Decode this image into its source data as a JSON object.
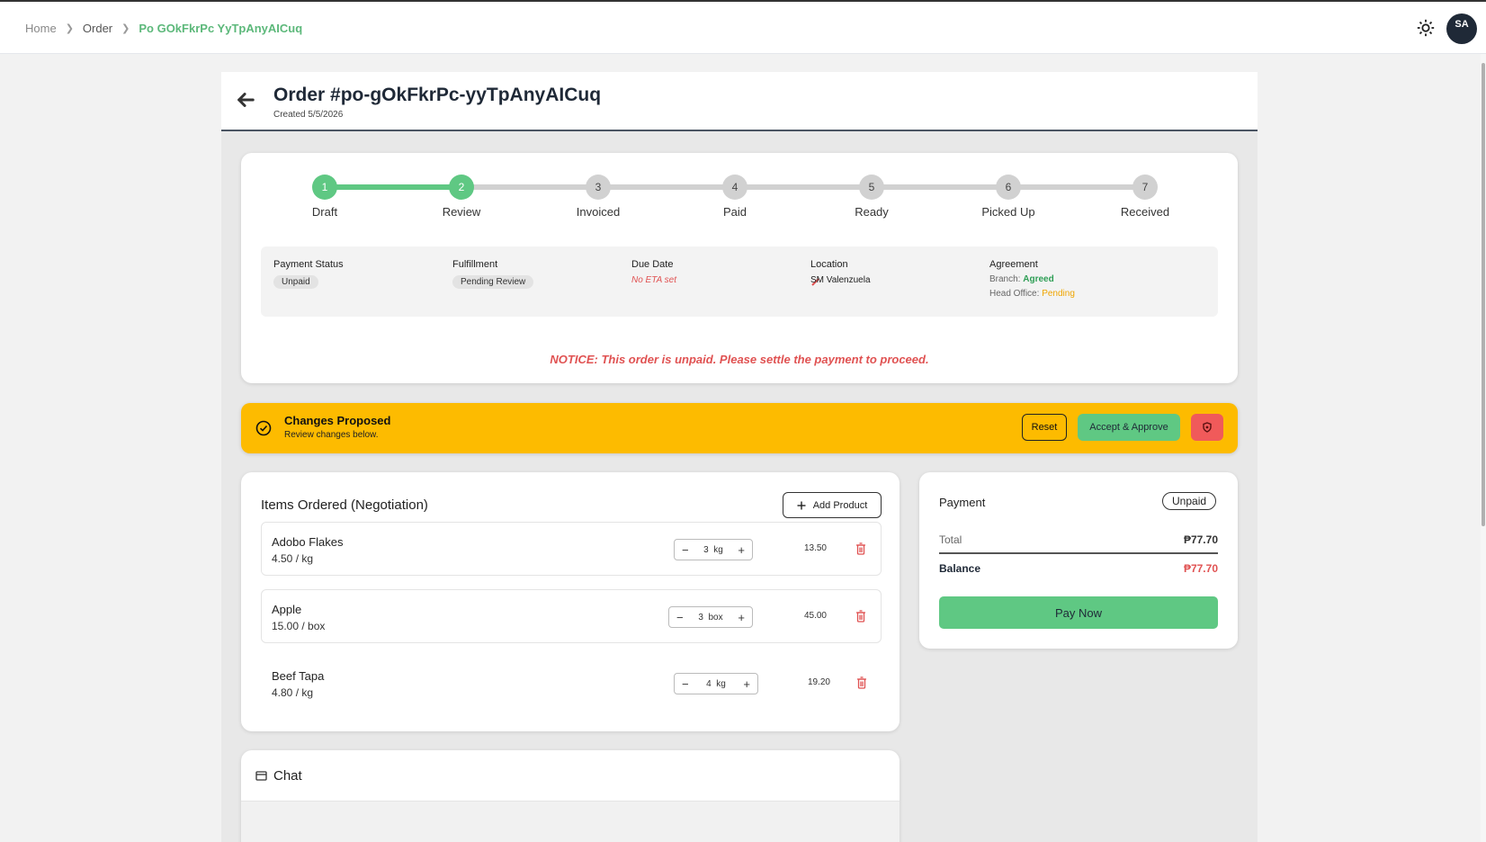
{
  "breadcrumb": {
    "home": "Home",
    "order": "Order",
    "current": "Po GOkFkrPc YyTpAnyAICuq"
  },
  "user": {
    "initials": "SA"
  },
  "order": {
    "title": "Order #po-gOkFkrPc-yyTpAnyAICuq",
    "created": "Created 5/5/2026"
  },
  "progress": {
    "current_step": 2,
    "steps": [
      {
        "num": "1",
        "label": "Draft"
      },
      {
        "num": "2",
        "label": "Review"
      },
      {
        "num": "3",
        "label": "Invoiced"
      },
      {
        "num": "4",
        "label": "Paid"
      },
      {
        "num": "5",
        "label": "Ready"
      },
      {
        "num": "6",
        "label": "Picked Up"
      },
      {
        "num": "7",
        "label": "Received"
      }
    ]
  },
  "info": {
    "payment_status_label": "Payment Status",
    "payment_status": "Unpaid",
    "fulfillment_label": "Fulfillment",
    "fulfillment": "Pending Review",
    "due_date_label": "Due Date",
    "due_date": "No ETA set",
    "location_label": "Location",
    "location": "SM Valenzuela",
    "agreement_label": "Agreement",
    "branch_label": "Branch:",
    "branch_status": "Agreed",
    "head_office_label": "Head Office:",
    "head_office_status": "Pending"
  },
  "notice": "NOTICE: This order is unpaid. Please settle the payment to proceed.",
  "banner": {
    "title": "Changes Proposed",
    "subtitle": "Review changes below.",
    "reset": "Reset",
    "accept": "Accept & Approve"
  },
  "items": {
    "title": "Items Ordered (Negotiation)",
    "add_label": "Add Product",
    "list": [
      {
        "name": "Adobo Flakes",
        "price": "4.50 / kg",
        "qty": "3",
        "unit": "kg",
        "subtotal": "13.50"
      },
      {
        "name": "Apple",
        "price": "15.00 / box",
        "qty": "3",
        "unit": "box",
        "subtotal": "45.00"
      },
      {
        "name": "Beef Tapa",
        "price": "4.80 / kg",
        "qty": "4",
        "unit": "kg",
        "subtotal": "19.20"
      }
    ]
  },
  "payment": {
    "title": "Payment",
    "badge": "Unpaid",
    "total_label": "Total",
    "total": "₱77.70",
    "balance_label": "Balance",
    "balance": "₱77.70",
    "pay_now": "Pay Now"
  },
  "chat": {
    "title": "Chat"
  },
  "colors": {
    "green": "#5fc883",
    "banner": "#fdbb00",
    "danger": "#e05252",
    "pending": "#f0a500"
  }
}
